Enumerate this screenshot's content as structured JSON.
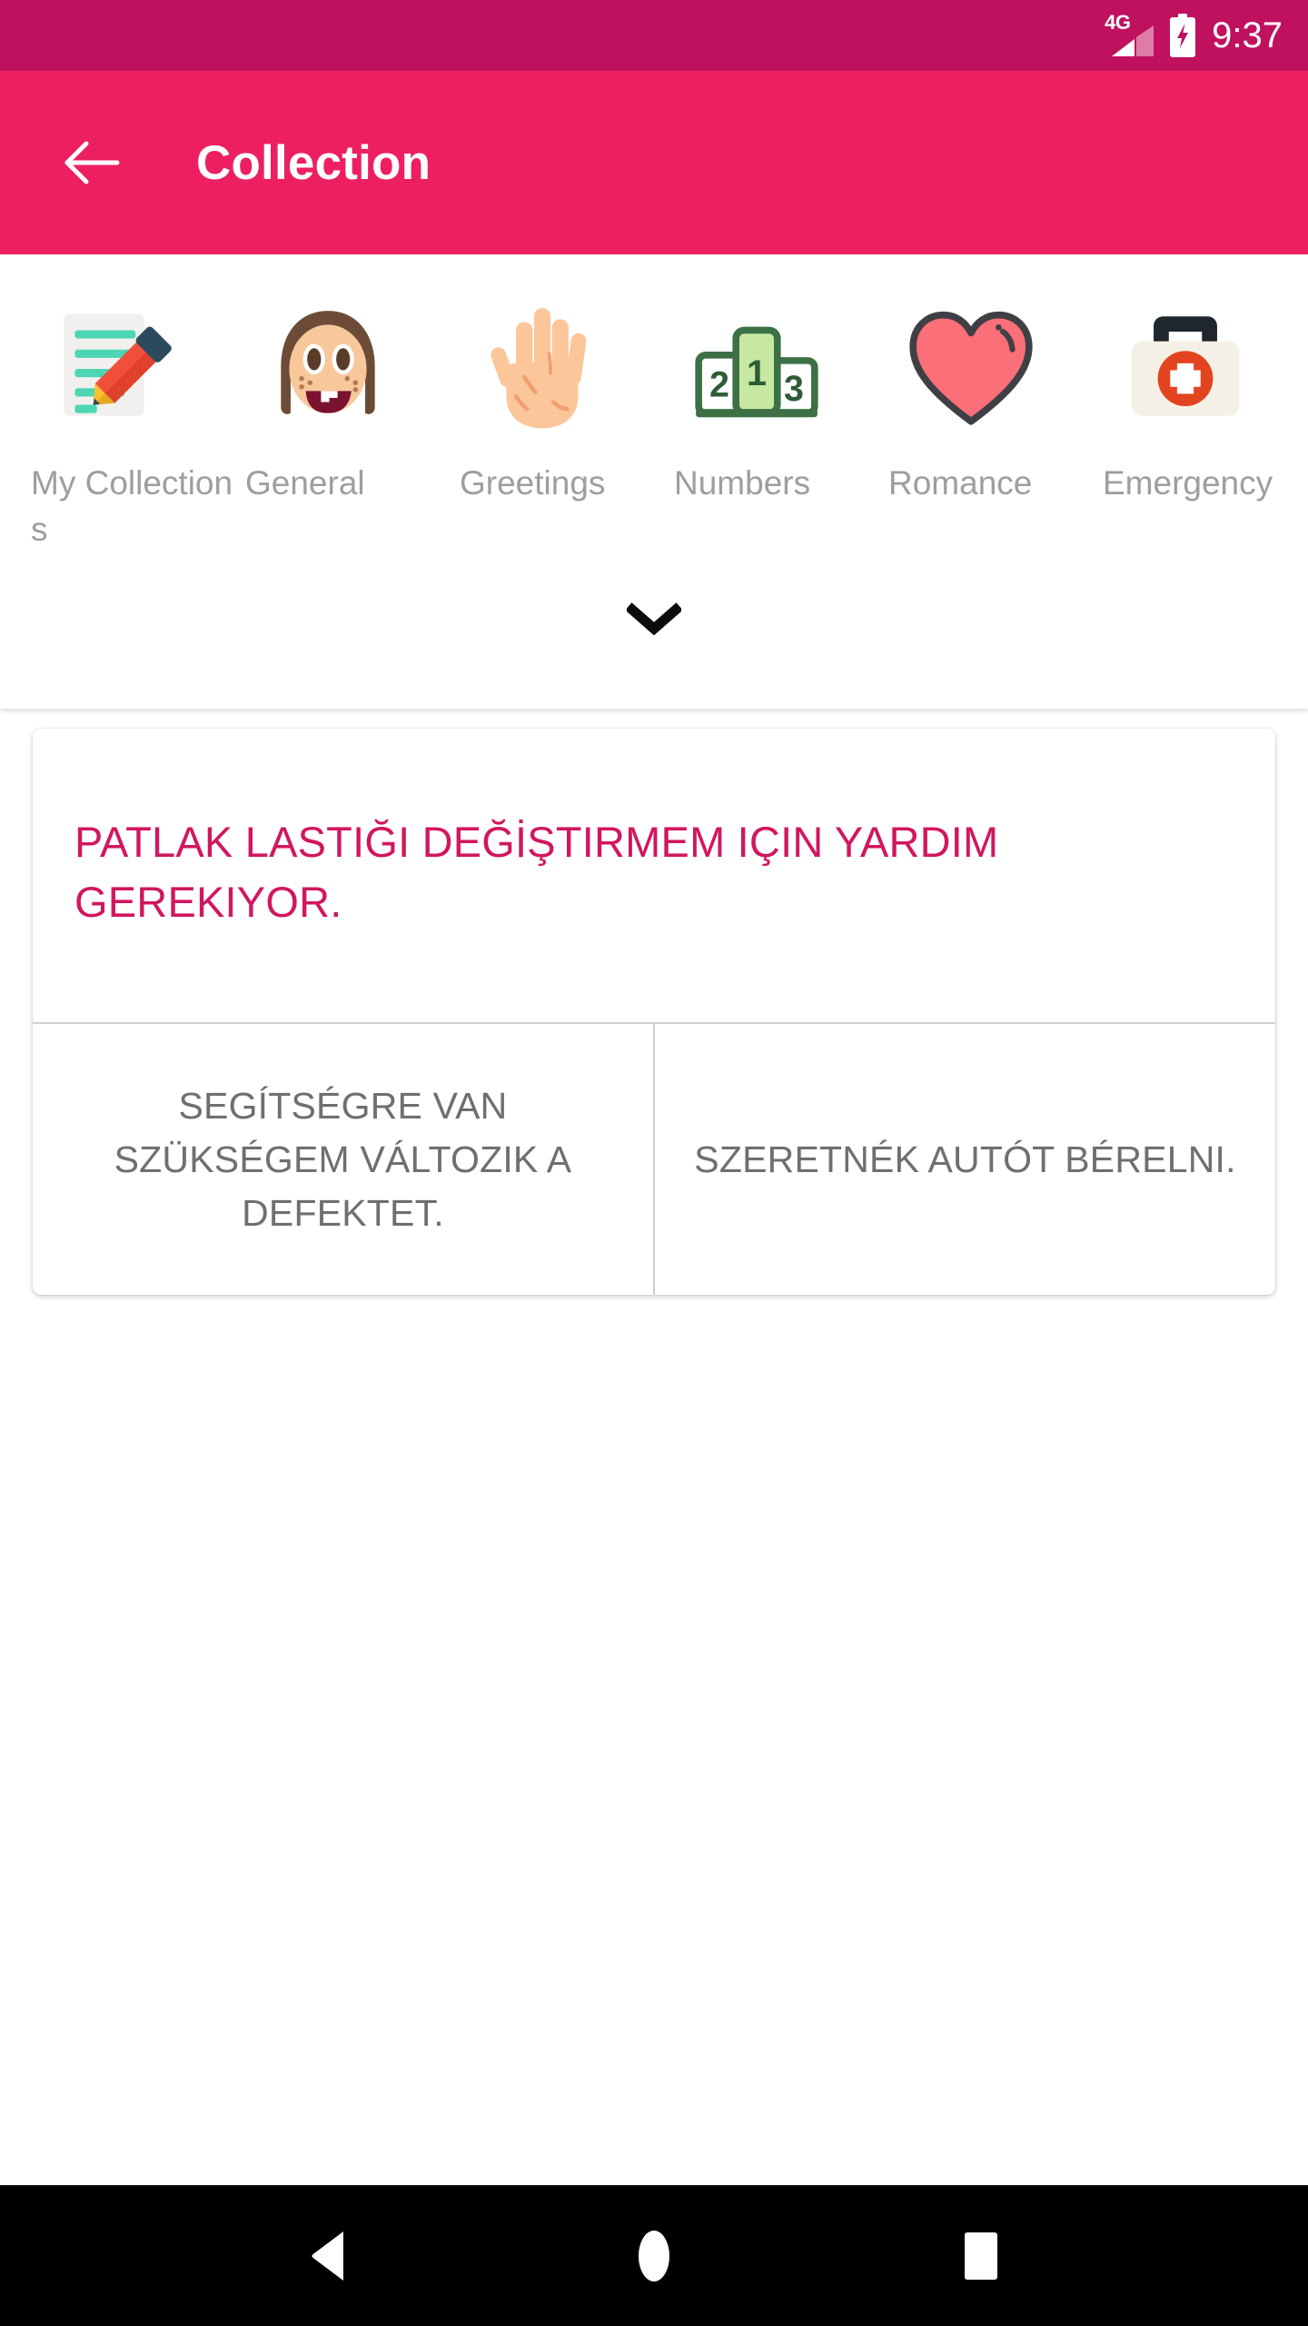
{
  "status_bar": {
    "network_label": "4G",
    "time": "9:37",
    "signal_icon": "signal-bars-icon",
    "battery_icon": "battery-charging-icon",
    "background_color": "#c0115f"
  },
  "app_bar": {
    "title": "Collection",
    "back_icon": "arrow-left-icon",
    "background_color": "#ec2060",
    "text_color": "#ffffff"
  },
  "categories": {
    "expand_icon": "chevron-down-icon",
    "label_color": "#9e9e9e",
    "items": [
      {
        "label": "My Collections",
        "icon": "memo-pencil-icon"
      },
      {
        "label": "General",
        "icon": "girl-face-icon"
      },
      {
        "label": "Greetings",
        "icon": "raised-hand-icon"
      },
      {
        "label": "Numbers",
        "icon": "podium-icon"
      },
      {
        "label": "Romance",
        "icon": "heart-icon"
      },
      {
        "label": "Emergency",
        "icon": "first-aid-kit-icon"
      }
    ]
  },
  "phrase_card": {
    "phrase": "PATLAK LASTIĞI DEĞİŞTIRMEM IÇIN YARDIM GEREKIYOR.",
    "phrase_color": "#d1175e",
    "suggestions": [
      "SEGÍTSÉGRE VAN SZÜKSÉGEM VÁLTOZIK A DEFEKTET.",
      "SZERETNÉK AUTÓT BÉRELNI."
    ],
    "suggestion_color": "#6f6f6f"
  },
  "nav_bar": {
    "back_icon": "triangle-back-icon",
    "home_icon": "circle-home-icon",
    "recents_icon": "square-recents-icon",
    "background_color": "#000000"
  }
}
